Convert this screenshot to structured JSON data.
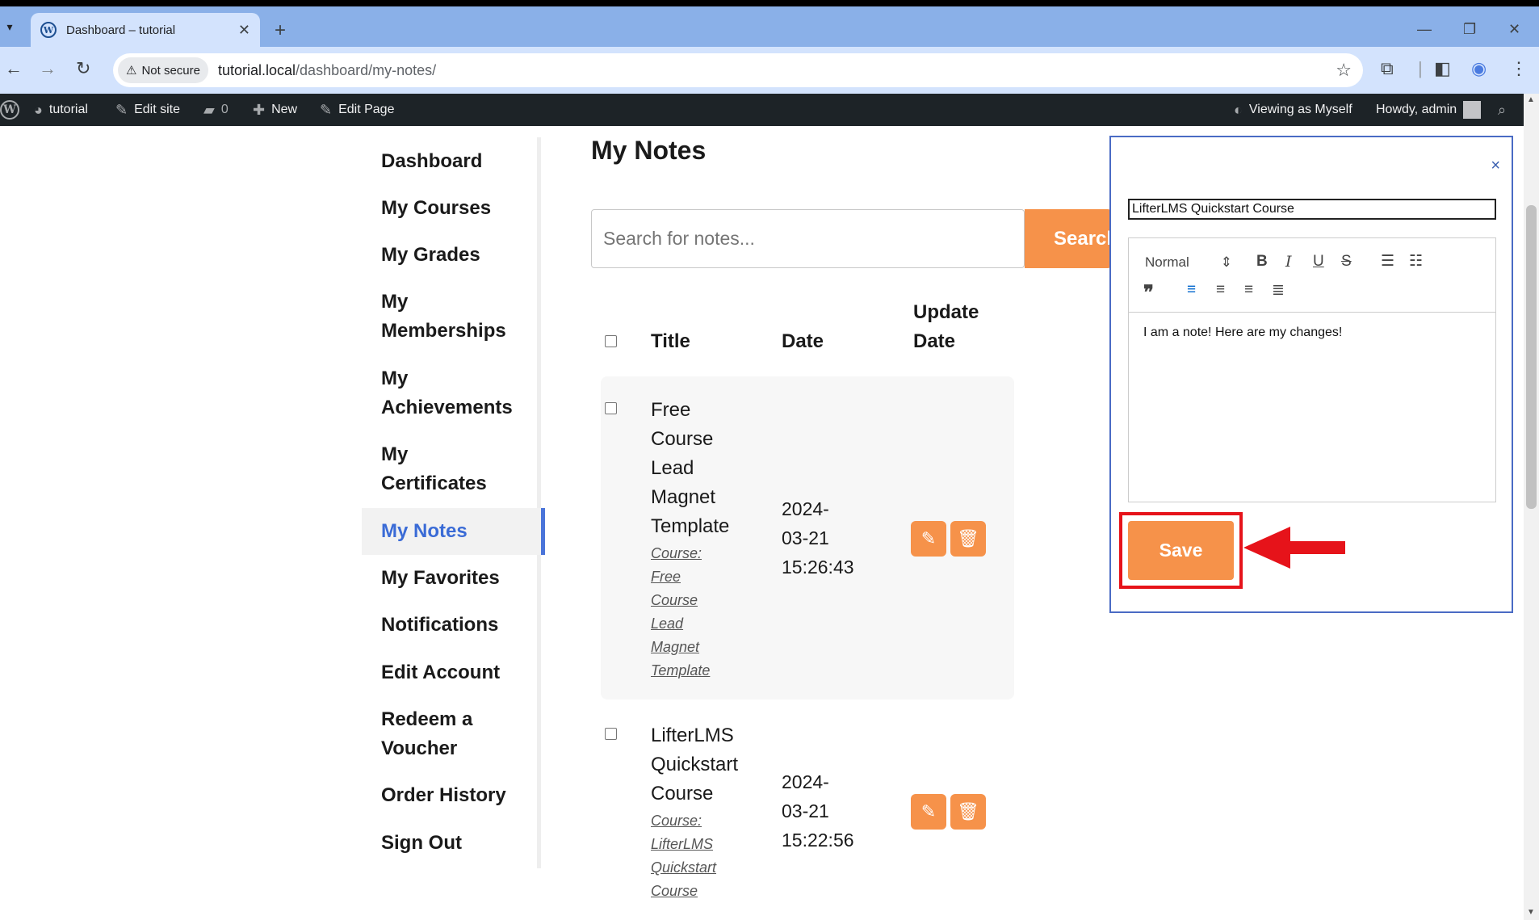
{
  "browser": {
    "tab_title": "Dashboard – tutorial",
    "tab_close": "✕",
    "new_tab": "+",
    "security_label": "Not secure",
    "url_host": "tutorial.local",
    "url_path": "/dashboard/my-notes/"
  },
  "adminbar": {
    "site_name": "tutorial",
    "edit_site": "Edit site",
    "comments_count": "0",
    "new_label": "New",
    "edit_page": "Edit Page",
    "viewing_as": "Viewing as Myself",
    "howdy": "Howdy, admin"
  },
  "sidebar": {
    "items": [
      {
        "lines": [
          "Dashboard"
        ]
      },
      {
        "lines": [
          "My Courses"
        ]
      },
      {
        "lines": [
          "My Grades"
        ]
      },
      {
        "lines": [
          "My",
          "Memberships"
        ]
      },
      {
        "lines": [
          "My",
          "Achievements"
        ]
      },
      {
        "lines": [
          "My",
          "Certificates"
        ]
      },
      {
        "lines": [
          "My Notes"
        ],
        "active": true
      },
      {
        "lines": [
          "My Favorites"
        ]
      },
      {
        "lines": [
          "Notifications"
        ]
      },
      {
        "lines": [
          "Edit Account"
        ]
      },
      {
        "lines": [
          "Redeem a",
          "Voucher"
        ]
      },
      {
        "lines": [
          "Order History"
        ]
      },
      {
        "lines": [
          "Sign Out"
        ]
      }
    ]
  },
  "main": {
    "title": "My Notes",
    "search_placeholder": "Search for notes...",
    "search_button": "Search",
    "table": {
      "headers": {
        "title": "Title",
        "date": "Date",
        "update_date_1": "Update",
        "update_date_2": "Date"
      },
      "rows": [
        {
          "title_lines": [
            "Free",
            "Course",
            "Lead",
            "Magnet",
            "Template"
          ],
          "course_lines": [
            "Course:",
            "Free",
            "Course",
            "Lead",
            "Magnet",
            "Template"
          ],
          "date_lines": [
            "2024-",
            "03-21",
            "15:26:43"
          ]
        },
        {
          "title_lines": [
            "LifterLMS",
            "Quickstart",
            "Course"
          ],
          "course_lines": [
            "Course:",
            "LifterLMS",
            "Quickstart",
            "Course"
          ],
          "date_lines": [
            "2024-",
            "03-21",
            "15:22:56"
          ]
        }
      ]
    }
  },
  "edit_panel": {
    "close": "×",
    "note_title": "LifterLMS Quickstart Course",
    "format_select": "Normal",
    "content": "I am a note! Here are my changes!",
    "save_label": "Save"
  },
  "colors": {
    "accent": "#f6924a",
    "highlight": "#e6131a",
    "active_link": "#3a6bd6"
  },
  "icons": [
    "wordpress-icon",
    "dashboard-icon",
    "brush-icon",
    "comment-icon",
    "plus-icon",
    "pencil-icon",
    "search-icon",
    "pencil-icon",
    "trash-icon",
    "arrow-left-icon"
  ]
}
